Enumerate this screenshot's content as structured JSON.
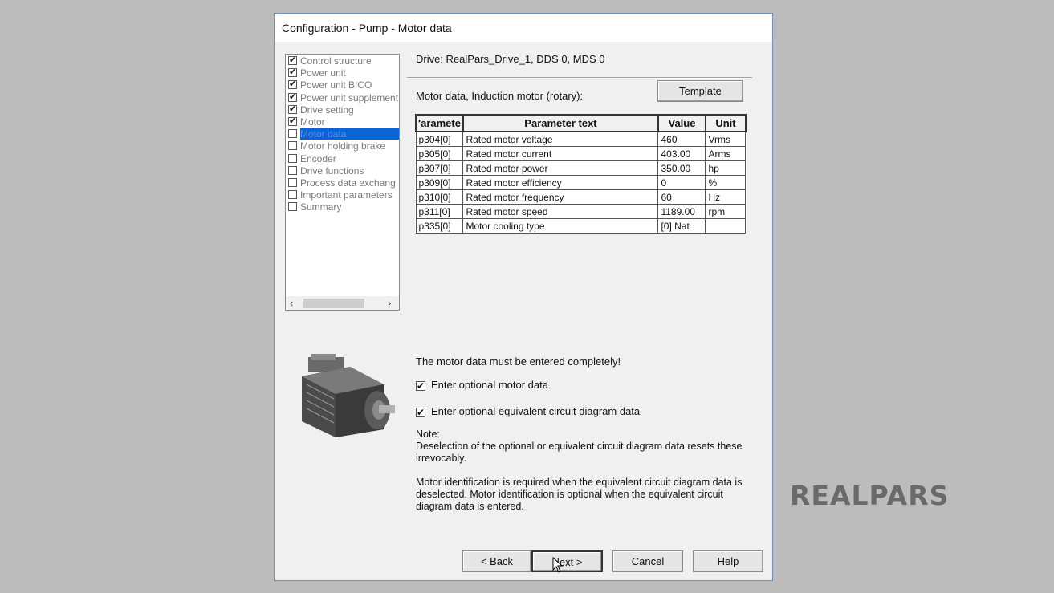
{
  "window": {
    "title": "Configuration - Pump - Motor data"
  },
  "tree": {
    "items": [
      {
        "label": "Control structure",
        "checked": true
      },
      {
        "label": "Power unit",
        "checked": true
      },
      {
        "label": "Power unit BICO",
        "checked": true
      },
      {
        "label": "Power unit supplement",
        "checked": true
      },
      {
        "label": "Drive setting",
        "checked": true
      },
      {
        "label": "Motor",
        "checked": true
      },
      {
        "label": "Motor data",
        "checked": false,
        "selected": true
      },
      {
        "label": "Motor holding brake",
        "checked": false
      },
      {
        "label": "Encoder",
        "checked": false
      },
      {
        "label": "Drive functions",
        "checked": false
      },
      {
        "label": "Process data exchang",
        "checked": false
      },
      {
        "label": "Important parameters",
        "checked": false
      },
      {
        "label": "Summary",
        "checked": false
      }
    ]
  },
  "panel": {
    "drive": "Drive: RealPars_Drive_1, DDS 0, MDS 0",
    "motor_type": "Motor data, Induction motor (rotary):",
    "template_label": "Template"
  },
  "table": {
    "headers": [
      "'aramete",
      "Parameter text",
      "Value",
      "Unit"
    ],
    "rows": [
      [
        "p304[0]",
        "Rated motor voltage",
        "460",
        "Vrms"
      ],
      [
        "p305[0]",
        "Rated motor current",
        "403.00",
        "Arms"
      ],
      [
        "p307[0]",
        "Rated motor power",
        "350.00",
        "hp"
      ],
      [
        "p309[0]",
        "Rated motor efficiency",
        "0",
        "%"
      ],
      [
        "p310[0]",
        "Rated motor frequency",
        "60",
        "Hz"
      ],
      [
        "p311[0]",
        "Rated motor speed",
        "1189.00",
        "rpm"
      ],
      [
        "p335[0]",
        "Motor cooling type",
        "[0] Nat",
        ""
      ]
    ]
  },
  "messages": {
    "must_enter": "The motor data must be entered completely!",
    "opt_motor": "Enter optional motor data",
    "opt_circuit": "Enter optional equivalent circuit diagram data",
    "note_title": "Note:",
    "note_1": "Deselection of the optional or equivalent circuit diagram data resets these irrevocably.",
    "note_2": "Motor identification is required when the equivalent circuit diagram data is deselected. Motor identification is optional when the equivalent circuit diagram data is entered."
  },
  "buttons": {
    "back": "< Back",
    "next": "Next >",
    "cancel": "Cancel",
    "help": "Help"
  },
  "brand": {
    "logo_text": "REALPARS"
  },
  "colors": {
    "selection": "#0a64d6",
    "background": "#bcbcbc",
    "dialog": "#f0f0f0"
  }
}
